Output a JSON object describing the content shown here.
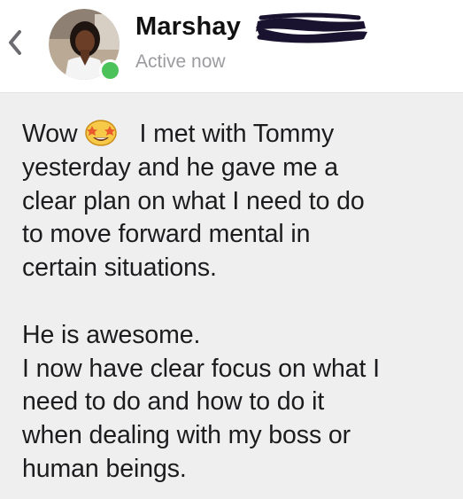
{
  "header": {
    "contact_name": "Marshay",
    "status": "Active now",
    "back_icon": "chevron-left-icon",
    "presence_color": "#4cc35a"
  },
  "message": {
    "paragraph_1": [
      "Wow",
      "I met with Tommy",
      "yesterday and he gave me a",
      "clear plan on what I need to do",
      "to move forward mental in",
      "certain situations."
    ],
    "paragraph_2": [
      "He is awesome.",
      "I now have clear focus on what I",
      "need to do and how to do it",
      "when dealing with my boss or",
      "human beings."
    ],
    "emoji": "star-struck-emoji-icon"
  }
}
